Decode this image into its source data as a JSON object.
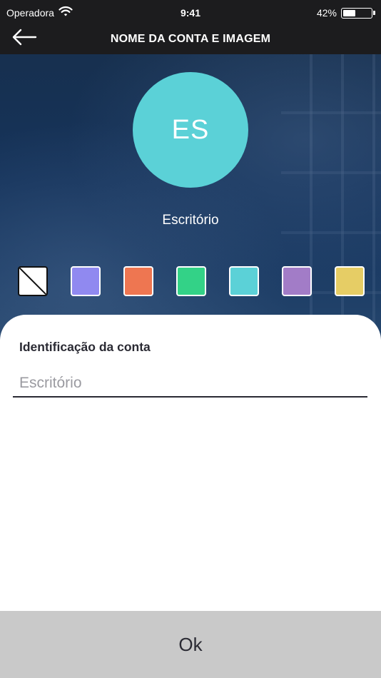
{
  "status_bar": {
    "carrier": "Operadora",
    "time": "9:41",
    "battery_percent": "42%",
    "battery_level": 0.42,
    "wifi_icon": "wifi-icon"
  },
  "header": {
    "title": "NOME DA CONTA E IMAGEM",
    "back_icon": "arrow-left-icon"
  },
  "avatar": {
    "initials": "ES",
    "color": "#5bd1d7"
  },
  "account": {
    "name": "Escritório"
  },
  "color_swatches": [
    {
      "name": "none",
      "color": "#ffffff"
    },
    {
      "name": "periwinkle",
      "color": "#9089f0"
    },
    {
      "name": "coral",
      "color": "#ee7651"
    },
    {
      "name": "green",
      "color": "#33d287"
    },
    {
      "name": "turquoise",
      "color": "#5bd1d7"
    },
    {
      "name": "purple",
      "color": "#a27cc7"
    },
    {
      "name": "yellow",
      "color": "#e6cd65"
    }
  ],
  "form": {
    "label": "Identificação da conta",
    "value": "Escritório",
    "placeholder": "Escritório"
  },
  "footer": {
    "ok_label": "Ok"
  }
}
